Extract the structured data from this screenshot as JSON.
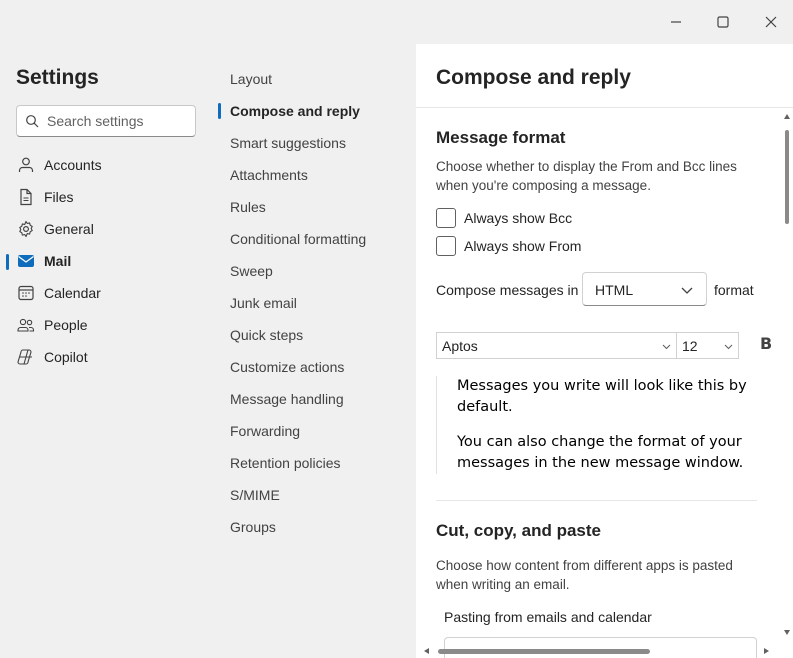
{
  "window": {
    "controls": [
      "minimize-icon",
      "maximize-icon",
      "close-icon"
    ]
  },
  "sidebar": {
    "title": "Settings",
    "search_placeholder": "Search settings",
    "items": [
      {
        "label": "Accounts",
        "icon": "person-icon",
        "active": false
      },
      {
        "label": "Files",
        "icon": "file-icon",
        "active": false
      },
      {
        "label": "General",
        "icon": "gear-icon",
        "active": false
      },
      {
        "label": "Mail",
        "icon": "mail-icon",
        "active": true
      },
      {
        "label": "Calendar",
        "icon": "calendar-icon",
        "active": false
      },
      {
        "label": "People",
        "icon": "people-icon",
        "active": false
      },
      {
        "label": "Copilot",
        "icon": "copilot-icon",
        "active": false
      }
    ]
  },
  "mail_nav": {
    "items": [
      {
        "label": "Layout",
        "active": false
      },
      {
        "label": "Compose and reply",
        "active": true
      },
      {
        "label": "Smart suggestions",
        "active": false
      },
      {
        "label": "Attachments",
        "active": false
      },
      {
        "label": "Rules",
        "active": false
      },
      {
        "label": "Conditional formatting",
        "active": false
      },
      {
        "label": "Sweep",
        "active": false
      },
      {
        "label": "Junk email",
        "active": false
      },
      {
        "label": "Quick steps",
        "active": false
      },
      {
        "label": "Customize actions",
        "active": false
      },
      {
        "label": "Message handling",
        "active": false
      },
      {
        "label": "Forwarding",
        "active": false
      },
      {
        "label": "Retention policies",
        "active": false
      },
      {
        "label": "S/MIME",
        "active": false
      },
      {
        "label": "Groups",
        "active": false
      }
    ]
  },
  "content": {
    "title": "Compose and reply",
    "message_format": {
      "heading": "Message format",
      "description": "Choose whether to display the From and Bcc lines when you're composing a message.",
      "always_show_bcc": {
        "label": "Always show Bcc",
        "checked": false
      },
      "always_show_from": {
        "label": "Always show From",
        "checked": false
      },
      "compose_prefix": "Compose messages in",
      "compose_format": "HTML",
      "compose_suffix": "format",
      "font": "Aptos",
      "font_size": "12",
      "bold_label": "B",
      "preview_line1": "Messages you write will look like this by default.",
      "preview_line2": "You can also change the format of your messages in the new message window."
    },
    "cut_copy_paste": {
      "heading": "Cut, copy, and paste",
      "description": "Choose how content from different apps is pasted when writing an email.",
      "pasting_label": "Pasting from emails and calendar"
    }
  },
  "colors": {
    "accent": "#0f6cbd",
    "background": "#f0f0f0",
    "panel": "#ffffff"
  }
}
